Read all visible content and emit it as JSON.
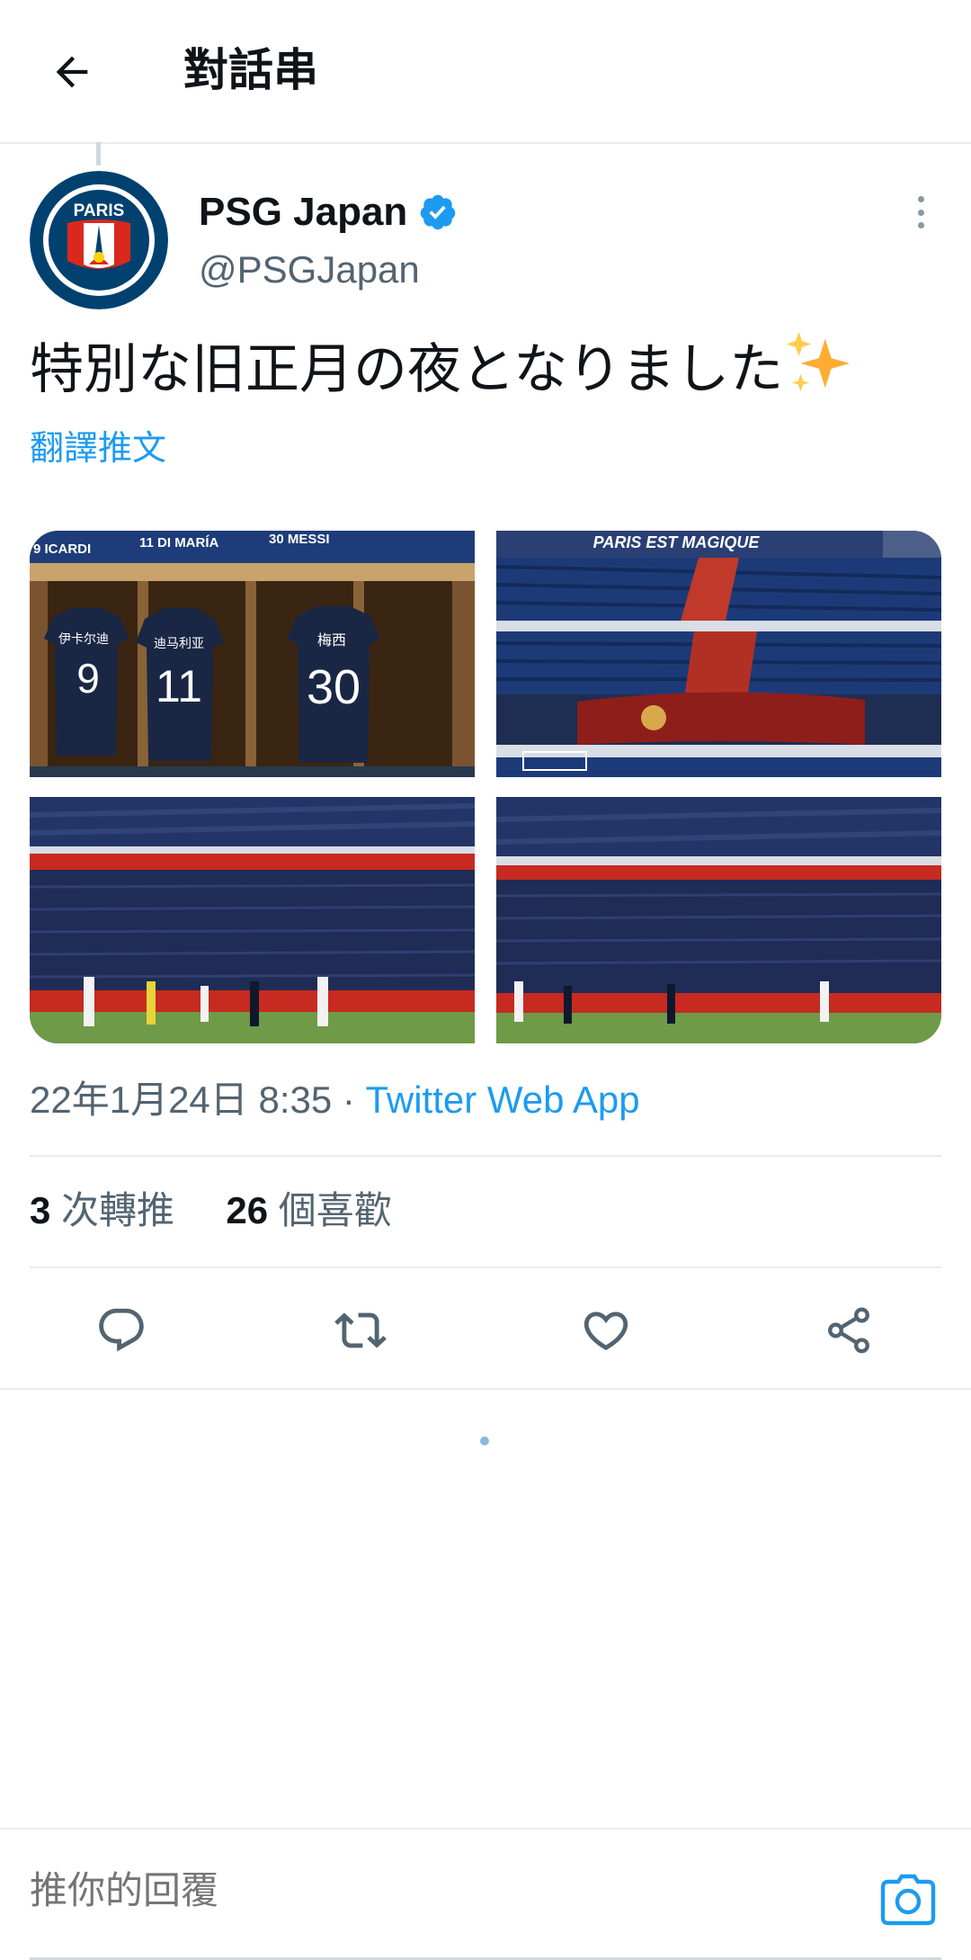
{
  "header": {
    "title": "對話串"
  },
  "tweet": {
    "display_name": "PSG Japan",
    "handle": "@PSGJapan",
    "avatar_text": "PARIS",
    "text": "特別な旧正月の夜となりました",
    "translate_label": "翻譯推文",
    "timestamp": "22年1月24日 8:35 · ",
    "source_app": "Twitter Web App",
    "retweets_count": "3",
    "retweets_label": " 次轉推",
    "likes_count": "26",
    "likes_label": " 個喜歡"
  },
  "media": {
    "photo1": {
      "banner_left": "9 ICARDI",
      "banner_mid": "11 DI MARÍA",
      "banner_right": "30 MESSI",
      "jerseys": [
        {
          "name": "伊卡尔迪",
          "number": "9"
        },
        {
          "name": "迪马利亚",
          "number": "11"
        },
        {
          "name": "梅西",
          "number": "30"
        }
      ]
    },
    "photo2": {
      "banner": "PARIS EST MAGIQUE"
    }
  },
  "reply": {
    "placeholder": "推你的回覆"
  },
  "colors": {
    "accent": "#1d9bf0",
    "muted": "#536471",
    "border": "#e6ecf0",
    "psg_navy": "#004170",
    "psg_red": "#da291c"
  }
}
